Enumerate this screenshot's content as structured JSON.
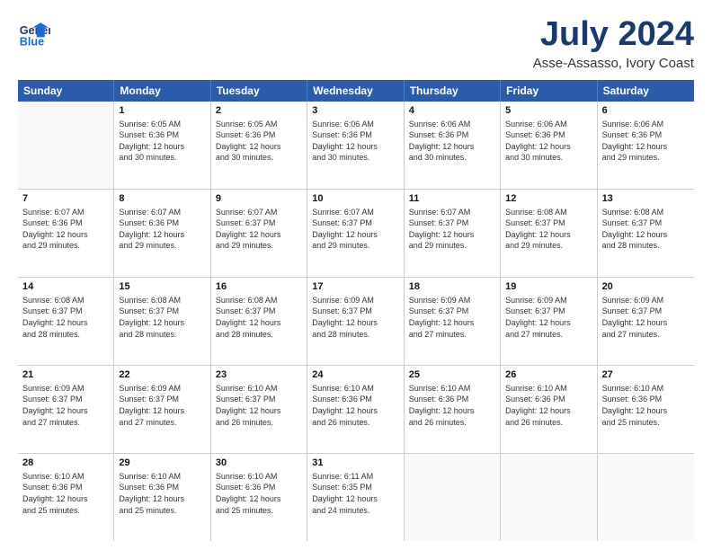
{
  "header": {
    "logo_line1": "General",
    "logo_line2": "Blue",
    "month_title": "July 2024",
    "location": "Asse-Assasso, Ivory Coast"
  },
  "weekdays": [
    "Sunday",
    "Monday",
    "Tuesday",
    "Wednesday",
    "Thursday",
    "Friday",
    "Saturday"
  ],
  "weeks": [
    [
      {
        "num": "",
        "info": ""
      },
      {
        "num": "1",
        "info": "Sunrise: 6:05 AM\nSunset: 6:36 PM\nDaylight: 12 hours\nand 30 minutes."
      },
      {
        "num": "2",
        "info": "Sunrise: 6:05 AM\nSunset: 6:36 PM\nDaylight: 12 hours\nand 30 minutes."
      },
      {
        "num": "3",
        "info": "Sunrise: 6:06 AM\nSunset: 6:36 PM\nDaylight: 12 hours\nand 30 minutes."
      },
      {
        "num": "4",
        "info": "Sunrise: 6:06 AM\nSunset: 6:36 PM\nDaylight: 12 hours\nand 30 minutes."
      },
      {
        "num": "5",
        "info": "Sunrise: 6:06 AM\nSunset: 6:36 PM\nDaylight: 12 hours\nand 30 minutes."
      },
      {
        "num": "6",
        "info": "Sunrise: 6:06 AM\nSunset: 6:36 PM\nDaylight: 12 hours\nand 29 minutes."
      }
    ],
    [
      {
        "num": "7",
        "info": "Sunrise: 6:07 AM\nSunset: 6:36 PM\nDaylight: 12 hours\nand 29 minutes."
      },
      {
        "num": "8",
        "info": "Sunrise: 6:07 AM\nSunset: 6:36 PM\nDaylight: 12 hours\nand 29 minutes."
      },
      {
        "num": "9",
        "info": "Sunrise: 6:07 AM\nSunset: 6:37 PM\nDaylight: 12 hours\nand 29 minutes."
      },
      {
        "num": "10",
        "info": "Sunrise: 6:07 AM\nSunset: 6:37 PM\nDaylight: 12 hours\nand 29 minutes."
      },
      {
        "num": "11",
        "info": "Sunrise: 6:07 AM\nSunset: 6:37 PM\nDaylight: 12 hours\nand 29 minutes."
      },
      {
        "num": "12",
        "info": "Sunrise: 6:08 AM\nSunset: 6:37 PM\nDaylight: 12 hours\nand 29 minutes."
      },
      {
        "num": "13",
        "info": "Sunrise: 6:08 AM\nSunset: 6:37 PM\nDaylight: 12 hours\nand 28 minutes."
      }
    ],
    [
      {
        "num": "14",
        "info": "Sunrise: 6:08 AM\nSunset: 6:37 PM\nDaylight: 12 hours\nand 28 minutes."
      },
      {
        "num": "15",
        "info": "Sunrise: 6:08 AM\nSunset: 6:37 PM\nDaylight: 12 hours\nand 28 minutes."
      },
      {
        "num": "16",
        "info": "Sunrise: 6:08 AM\nSunset: 6:37 PM\nDaylight: 12 hours\nand 28 minutes."
      },
      {
        "num": "17",
        "info": "Sunrise: 6:09 AM\nSunset: 6:37 PM\nDaylight: 12 hours\nand 28 minutes."
      },
      {
        "num": "18",
        "info": "Sunrise: 6:09 AM\nSunset: 6:37 PM\nDaylight: 12 hours\nand 27 minutes."
      },
      {
        "num": "19",
        "info": "Sunrise: 6:09 AM\nSunset: 6:37 PM\nDaylight: 12 hours\nand 27 minutes."
      },
      {
        "num": "20",
        "info": "Sunrise: 6:09 AM\nSunset: 6:37 PM\nDaylight: 12 hours\nand 27 minutes."
      }
    ],
    [
      {
        "num": "21",
        "info": "Sunrise: 6:09 AM\nSunset: 6:37 PM\nDaylight: 12 hours\nand 27 minutes."
      },
      {
        "num": "22",
        "info": "Sunrise: 6:09 AM\nSunset: 6:37 PM\nDaylight: 12 hours\nand 27 minutes."
      },
      {
        "num": "23",
        "info": "Sunrise: 6:10 AM\nSunset: 6:37 PM\nDaylight: 12 hours\nand 26 minutes."
      },
      {
        "num": "24",
        "info": "Sunrise: 6:10 AM\nSunset: 6:36 PM\nDaylight: 12 hours\nand 26 minutes."
      },
      {
        "num": "25",
        "info": "Sunrise: 6:10 AM\nSunset: 6:36 PM\nDaylight: 12 hours\nand 26 minutes."
      },
      {
        "num": "26",
        "info": "Sunrise: 6:10 AM\nSunset: 6:36 PM\nDaylight: 12 hours\nand 26 minutes."
      },
      {
        "num": "27",
        "info": "Sunrise: 6:10 AM\nSunset: 6:36 PM\nDaylight: 12 hours\nand 25 minutes."
      }
    ],
    [
      {
        "num": "28",
        "info": "Sunrise: 6:10 AM\nSunset: 6:36 PM\nDaylight: 12 hours\nand 25 minutes."
      },
      {
        "num": "29",
        "info": "Sunrise: 6:10 AM\nSunset: 6:36 PM\nDaylight: 12 hours\nand 25 minutes."
      },
      {
        "num": "30",
        "info": "Sunrise: 6:10 AM\nSunset: 6:36 PM\nDaylight: 12 hours\nand 25 minutes."
      },
      {
        "num": "31",
        "info": "Sunrise: 6:11 AM\nSunset: 6:35 PM\nDaylight: 12 hours\nand 24 minutes."
      },
      {
        "num": "",
        "info": ""
      },
      {
        "num": "",
        "info": ""
      },
      {
        "num": "",
        "info": ""
      }
    ]
  ]
}
